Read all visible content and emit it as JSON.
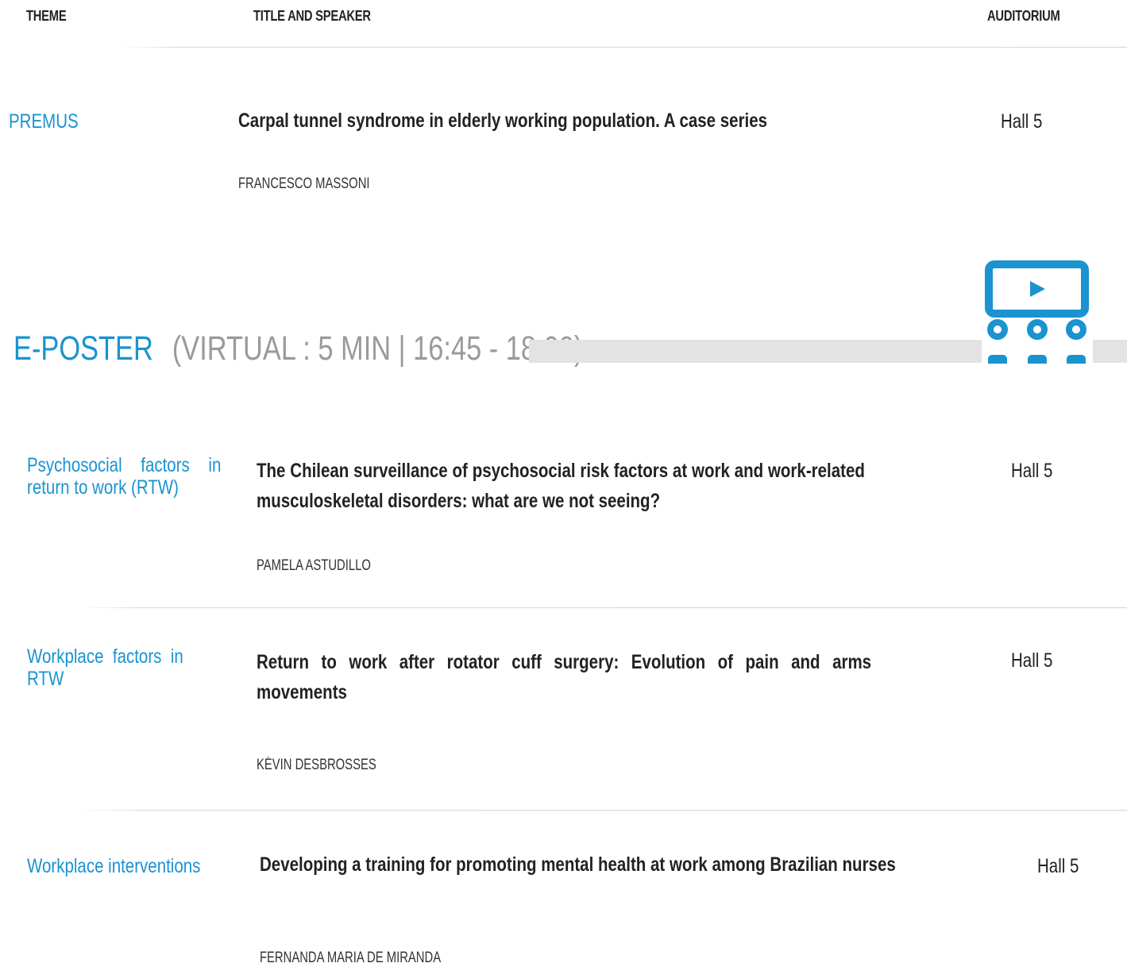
{
  "headers": {
    "theme": "THEME",
    "title_speaker": "TITLE AND SPEAKER",
    "auditorium": "AUDITORIUM"
  },
  "premus_session": {
    "theme": "PREMUS",
    "title": "Carpal tunnel syndrome in elderly working population. A case series",
    "speaker": "FRANCESCO MASSONI",
    "hall": "Hall 5"
  },
  "eposter_section": {
    "title": "E-POSTER",
    "subtitle": "(VIRTUAL : 5 MIN | 16:45 - 18:00)",
    "icon": "video-conference-icon",
    "icon_color": "#1a93d0"
  },
  "eposters": [
    {
      "theme": "Psychosocial factors in return to work (RTW)",
      "title": "The Chilean surveillance of psychosocial risk factors at work and work-related musculoskeletal disorders: what are we not seeing?",
      "speaker": "PAMELA ASTUDILLO",
      "hall": "Hall 5"
    },
    {
      "theme": "Workplace factors in RTW",
      "title": "Return to work after rotator cuff surgery: Evolution of pain and arms movements",
      "speaker": "KÉVIN DESBROSSES",
      "hall": "Hall 5"
    },
    {
      "theme": "Workplace interventions",
      "title": "Developing a training for promoting mental health at work among Brazilian nurses",
      "speaker": "FERNANDA MARIA DE MIRANDA",
      "hall": "Hall 5"
    }
  ],
  "colors": {
    "accent": "#1a93d0",
    "muted": "#9a9a9a",
    "bar": "#e3e3e3",
    "text": "#222222"
  }
}
